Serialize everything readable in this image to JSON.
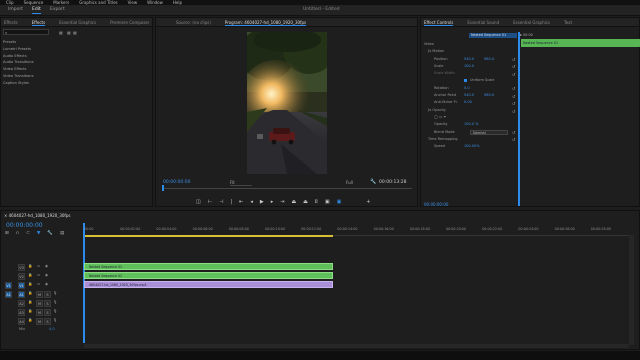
{
  "menubar": {
    "items": [
      "Clip",
      "Sequence",
      "Markers",
      "Graphics and Titles",
      "View",
      "Window",
      "Help"
    ]
  },
  "workspace": {
    "tabs": [
      "Import",
      "Edit",
      "Export"
    ],
    "active": "Edit",
    "title": "Untitled - Edited"
  },
  "left_panel": {
    "tabs": [
      "Effects",
      "Effects",
      "Essential Graphics",
      "Premiere Composer",
      "Lib"
    ],
    "active_tab": "Effects",
    "search_placeholder": "",
    "items": [
      "Presets",
      "Lumetri Presets",
      "Audio Effects",
      "Audio Transitions",
      "Video Effects",
      "Video Transitions",
      "Caption Styles"
    ]
  },
  "source_panel": {
    "tabs": [
      "Source: (no clips)",
      "Program: 4604027-hd_1080_1920_30fps"
    ],
    "active_tab": "Program: 4604027-hd_1080_1920_30fps"
  },
  "program": {
    "timecode": "00:00:00:00",
    "fit": "Fit",
    "quality": "Full",
    "duration": "00:00:13:28"
  },
  "effect_controls": {
    "tabs": [
      "Effect Controls",
      "Essential Sound",
      "Essential Graphics",
      "Text"
    ],
    "active_tab": "Effect Controls",
    "source_clip": "Nested Sequence 01",
    "mini_timecode": "00:00",
    "clip_label": "Nested Sequence 01",
    "section_video": "Video",
    "motion": "Motion",
    "rows": [
      {
        "label": "Position",
        "v1": "540.0",
        "v2": "960.0"
      },
      {
        "label": "Scale",
        "v1": "100.0",
        "v2": ""
      },
      {
        "label": "Scale Width",
        "v1": "",
        "v2": ""
      },
      {
        "label": "",
        "v1": "",
        "v2": "Uniform Scale"
      },
      {
        "label": "Rotation",
        "v1": "0.0",
        "v2": ""
      },
      {
        "label": "Anchor Point",
        "v1": "540.0",
        "v2": "960.0"
      },
      {
        "label": "Anti-flicker Fi.",
        "v1": "0.00",
        "v2": ""
      }
    ],
    "opacity": "Opacity",
    "opacity_rows": [
      {
        "label": "Opacity",
        "v": "100.0 %"
      },
      {
        "label": "Blend Mode",
        "v": "Normal"
      }
    ],
    "time_remap": "Time Remapping",
    "speed": {
      "label": "Speed",
      "v": "100.00%"
    },
    "bottom_timecode": "00:00:00:00"
  },
  "timeline": {
    "name": "4604027-hd_1080_1920_30fps",
    "timecode": "00:00:00:00",
    "ruler": [
      "00:00",
      "00:00:02:00",
      "00:00:04:00",
      "00:00:06:00",
      "00:00:08:00",
      "00:00:10:00",
      "00:00:12:00",
      "00:00:14:00",
      "00:00:16:00",
      "00:00:18:00",
      "00:00:20:00",
      "00:00:22:00",
      "00:00:24:00",
      "00:00:26:00",
      "00:00:28:00"
    ],
    "tracks": [
      "V3",
      "V2",
      "V1",
      "A1",
      "A2",
      "A3",
      "A4",
      "Mix"
    ],
    "mix_value": "0.0",
    "clips": [
      {
        "name": "Nested Sequence 01",
        "color": "#5fbf5a"
      },
      {
        "name": "Nested Sequence 01",
        "color": "#5fbf5a"
      },
      {
        "name": "4604027-hd_1080_1920_30fps.mp4",
        "color": "#a990d6"
      }
    ]
  }
}
